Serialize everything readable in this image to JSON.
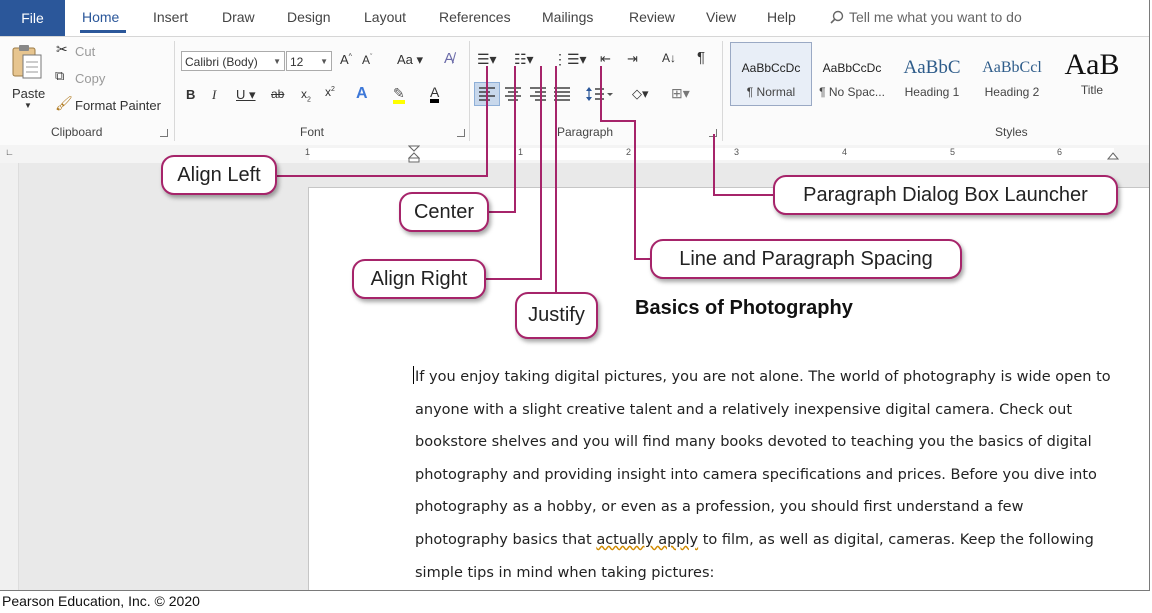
{
  "tabs": {
    "file": "File",
    "items": [
      "Home",
      "Insert",
      "Draw",
      "Design",
      "Layout",
      "References",
      "Mailings",
      "Review",
      "View",
      "Help"
    ],
    "tell_me": "Tell me what you want to do"
  },
  "clipboard": {
    "paste": "Paste",
    "cut": "Cut",
    "copy": "Copy",
    "format_painter": "Format Painter",
    "group_label": "Clipboard"
  },
  "font": {
    "name": "Calibri (Body)",
    "size": "12",
    "group_label": "Font"
  },
  "paragraph": {
    "group_label": "Paragraph"
  },
  "styles": {
    "group_label": "Styles",
    "items": [
      {
        "sample": "AaBbCcDc",
        "name": "¶ Normal"
      },
      {
        "sample": "AaBbCcDc",
        "name": "¶ No Spac..."
      },
      {
        "sample": "AaBbC",
        "name": "Heading 1"
      },
      {
        "sample": "AaBbCcl",
        "name": "Heading 2"
      },
      {
        "sample": "AaB",
        "name": "Title"
      }
    ]
  },
  "ruler": {
    "numbers": [
      "1",
      "1",
      "2",
      "3",
      "4",
      "5",
      "6"
    ]
  },
  "document": {
    "title": "Basics of Photography",
    "lines": [
      "If you enjoy taking digital pictures, you are not alone. The world of photography is wide open to",
      "anyone with a slight creative talent and a relatively inexpensive digital camera. Check out",
      "bookstore shelves and you will find many books devoted to teaching you the basics of digital",
      "photography and providing insight into camera specifications and prices. Before you dive into",
      "photography as a hobby, or even as a profession, you should first understand a few"
    ],
    "line6_before": "photography basics that ",
    "line6_squiggle": "actually apply",
    "line6_after": " to film, as well as digital, cameras. Keep the following",
    "line7": "simple tips in mind when taking pictures:"
  },
  "callouts": {
    "align_left": "Align Left",
    "center": "Center",
    "align_right": "Align Right",
    "justify": "Justify",
    "paragraph_launcher": "Paragraph Dialog Box Launcher",
    "line_spacing": "Line and Paragraph Spacing"
  },
  "copyright": "Pearson Education, Inc. © 2020",
  "colors": {
    "accent": "#2b579a",
    "callout_border": "#a6246a"
  }
}
